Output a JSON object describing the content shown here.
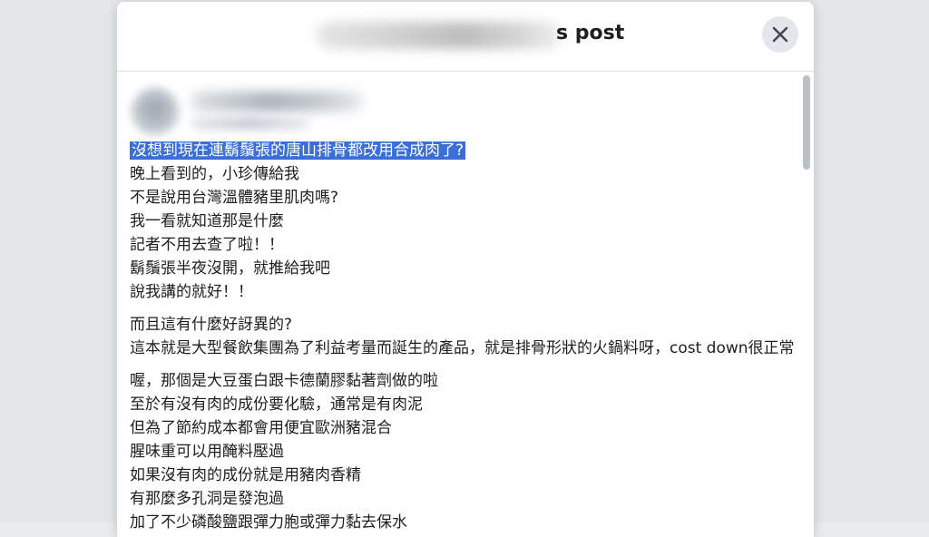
{
  "dialog": {
    "title_suffix": "s post"
  },
  "icons": {
    "close": "close-icon"
  },
  "post": {
    "paragraphs": [
      {
        "lines": [
          {
            "text": "沒想到現在連鬍鬚張的唐山排骨都改用合成肉了?",
            "selected": true
          },
          {
            "text": "晚上看到的，小珍傳給我"
          },
          {
            "text": "不是說用台灣溫體豬里肌肉嗎?"
          },
          {
            "text": "我一看就知道那是什麼"
          },
          {
            "text": "記者不用去查了啦！！"
          },
          {
            "text": "鬍鬚張半夜沒開，就推給我吧"
          },
          {
            "text": "說我講的就好！！"
          }
        ]
      },
      {
        "lines": [
          {
            "text": "而且這有什麼好訝異的?"
          },
          {
            "text": "這本就是大型餐飲集團為了利益考量而誕生的產品，就是排骨形狀的火鍋料呀，cost down很正常"
          }
        ]
      },
      {
        "lines": [
          {
            "text": "喔，那個是大豆蛋白跟卡德蘭膠黏著劑做的啦"
          },
          {
            "text": "至於有沒有肉的成份要化驗，通常是有肉泥"
          },
          {
            "text": "但為了節約成本都會用便宜歐洲豬混合"
          },
          {
            "text": "腥味重可以用醃料壓過"
          },
          {
            "text": "如果沒有肉的成份就是用豬肉香精"
          },
          {
            "text": "有那麼多孔洞是發泡過"
          },
          {
            "text": "加了不少磷酸鹽跟彈力胞或彈力黏去保水"
          }
        ]
      }
    ]
  },
  "colors": {
    "selection": "#3b6fd8",
    "close_button_bg": "#e4e6eb"
  }
}
